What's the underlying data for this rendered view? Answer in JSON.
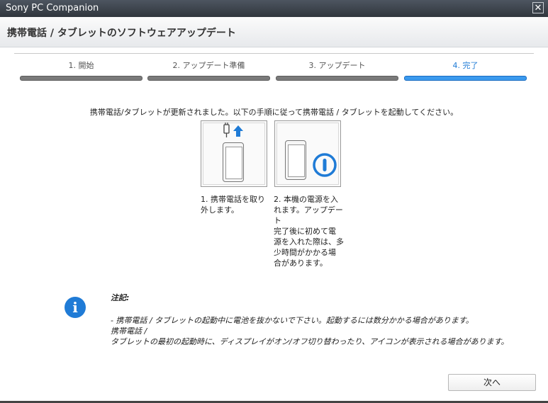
{
  "window": {
    "title": "Sony PC Companion",
    "close_symbol": "✕"
  },
  "header": {
    "title": "携帯電話 / タブレットのソフトウェアアップデート"
  },
  "steps": [
    {
      "label": "1. 開始",
      "active": false
    },
    {
      "label": "2. アップデート準備",
      "active": false
    },
    {
      "label": "3. アップデート",
      "active": false
    },
    {
      "label": "4. 完了",
      "active": true
    }
  ],
  "main": {
    "instruction": "携帯電話/タブレットが更新されました。以下の手順に従って携帯電話 / タブレットを起動してください。",
    "cards": [
      {
        "icon": "phone-unplug-icon",
        "caption_lines": [
          "1. 携帯電話を取り",
          "外します。"
        ]
      },
      {
        "icon": "phone-power-icon",
        "caption_lines": [
          "2. 本機の電源を入",
          "れます。アップデート",
          "完了後に初めて電",
          "源を入れた際は、多",
          "少時間がかかる場",
          "合があります。"
        ]
      }
    ]
  },
  "note": {
    "icon": "info-icon",
    "title": "注記:",
    "lines": [
      "- 携帯電話 / タブレットの起動中に電池を抜かないで下さい。起動するには数分かかる場合があります。",
      "携帯電話 /",
      "タブレットの最初の起動時に、ディスプレイがオン/オフ切り替わったり、アイコンが表示される場合があります。"
    ]
  },
  "footer": {
    "next_label": "次へ"
  },
  "colors": {
    "accent": "#1f7bd6",
    "active_bar": "#3b9aee",
    "inactive_bar": "#7a7a7a",
    "titlebar": "#3b424a"
  }
}
